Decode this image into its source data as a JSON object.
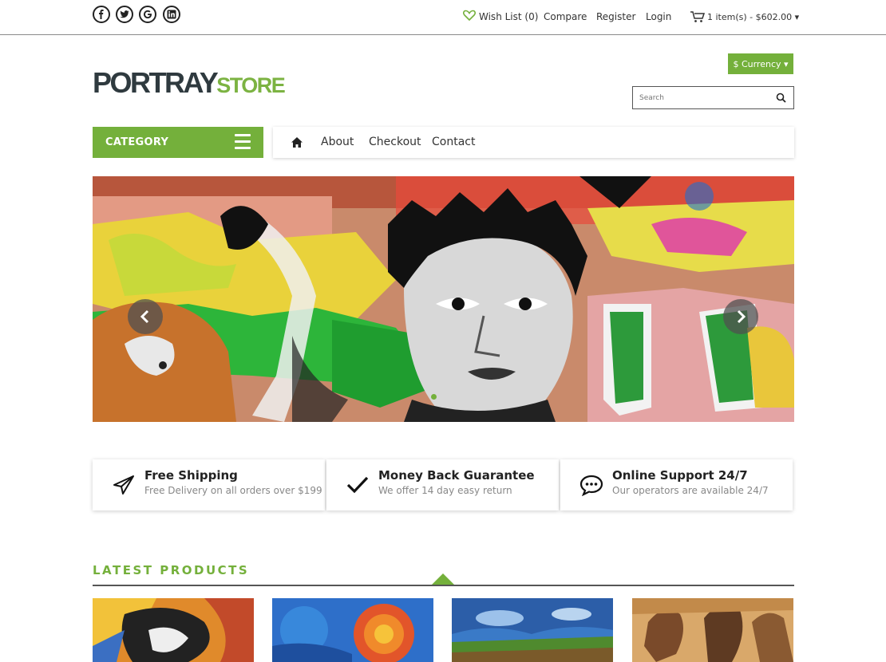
{
  "colors": {
    "accent": "#74b03b",
    "dark": "#2f3a3f"
  },
  "topbar": {
    "social_icons": [
      "facebook-icon",
      "twitter-icon",
      "google-icon",
      "linkedin-icon"
    ],
    "wishlist": "Wish List (0)",
    "compare": "Compare",
    "register": "Register",
    "login": "Login",
    "cart": "1 item(s) - $602.00 ▾"
  },
  "header": {
    "logo_part1": "PORTRAY",
    "logo_part2": "STORE",
    "currency": "$ Currency ▾",
    "search_placeholder": "Search"
  },
  "category": {
    "label": "CATEGORY"
  },
  "nav": {
    "items": [
      "About",
      "Checkout",
      "Contact"
    ]
  },
  "features": [
    {
      "icon": "paper-plane-icon",
      "title": "Free Shipping",
      "subtitle": "Free Delivery on all orders over $199"
    },
    {
      "icon": "checkmark-icon",
      "title": "Money Back Guarantee",
      "subtitle": "We offer 14 day easy return"
    },
    {
      "icon": "chat-bubble-icon",
      "title": "Online Support 24/7",
      "subtitle": "Our operators are available 24/7"
    }
  ],
  "latest": {
    "title": "LATEST PRODUCTS"
  }
}
